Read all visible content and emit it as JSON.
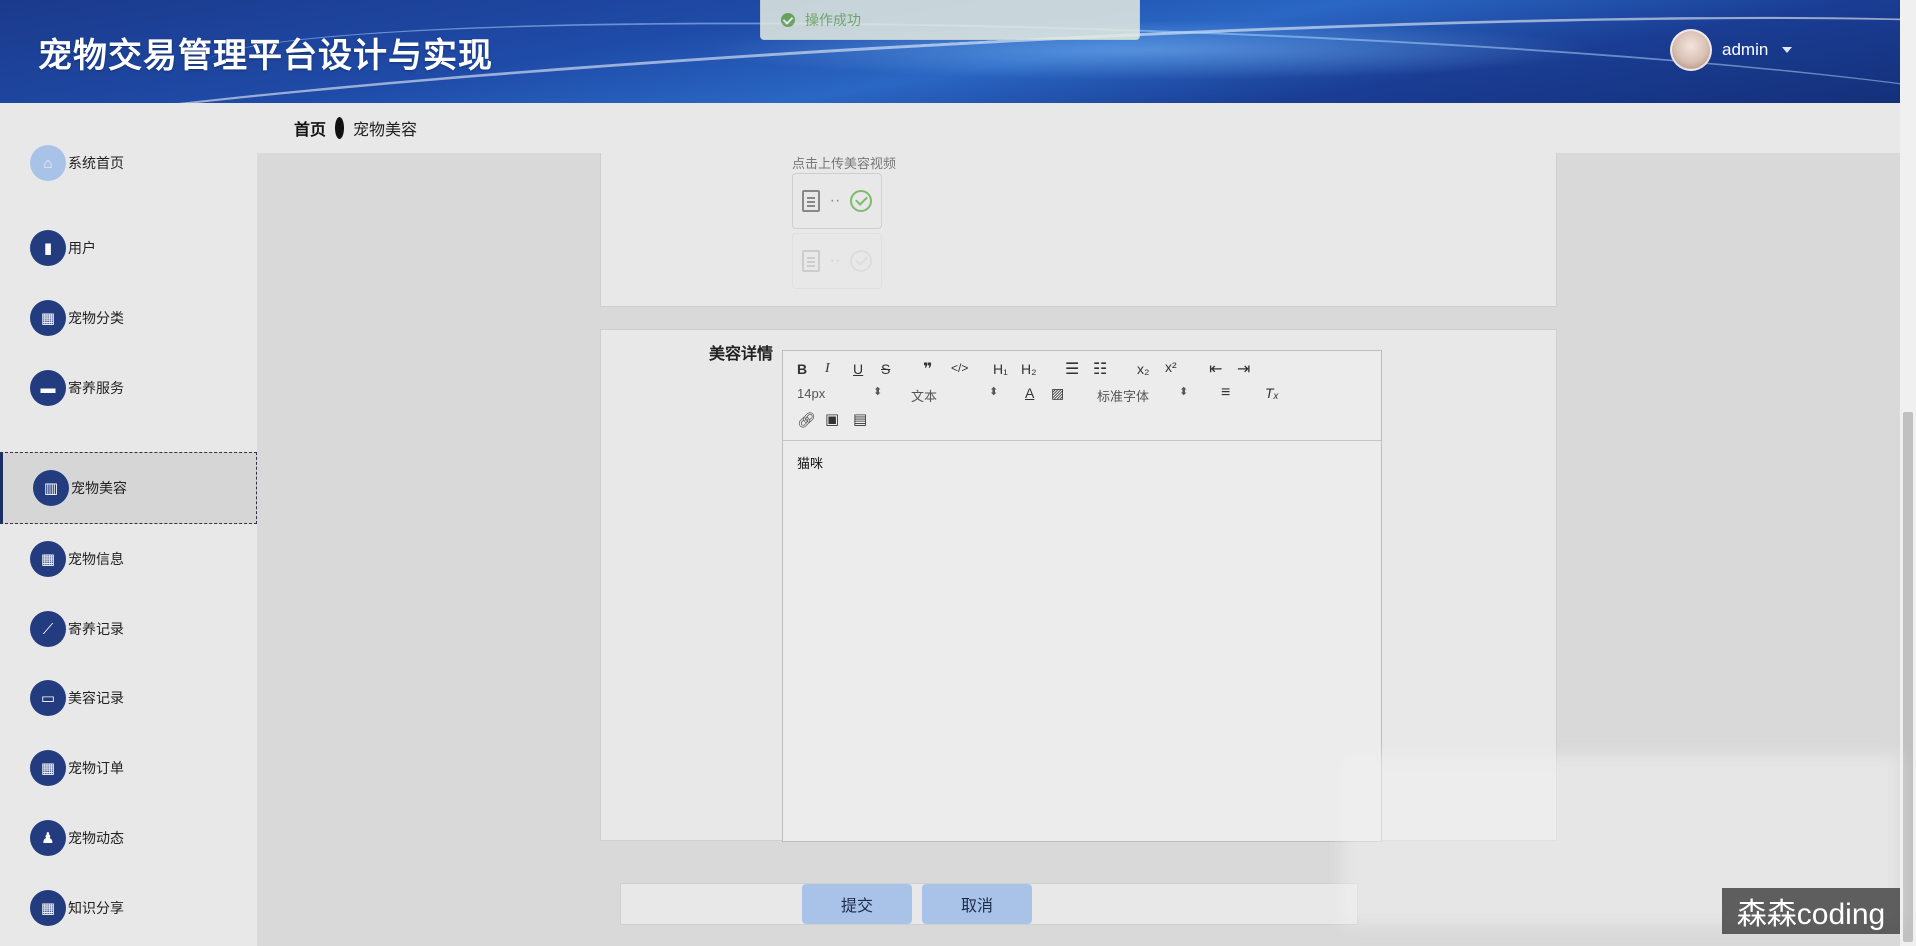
{
  "header": {
    "app_title": "宠物交易管理平台设计与实现",
    "username": "admin"
  },
  "toast": {
    "message": "操作成功"
  },
  "breadcrumb": {
    "home": "首页",
    "current": "宠物美容"
  },
  "sidebar": {
    "items": [
      {
        "label": "系统首页",
        "icon": "home-icon",
        "glyph": "⌂"
      },
      {
        "label": "用户",
        "icon": "user-icon",
        "glyph": "▮"
      },
      {
        "label": "宠物分类",
        "icon": "grid-icon",
        "glyph": "▦"
      },
      {
        "label": "寄养服务",
        "icon": "ticket-icon",
        "glyph": "▬"
      },
      {
        "label": "宠物美容",
        "icon": "bar-chart-icon",
        "glyph": "▥"
      },
      {
        "label": "宠物信息",
        "icon": "grid-icon",
        "glyph": "▦"
      },
      {
        "label": "寄养记录",
        "icon": "line-chart-icon",
        "glyph": "⟋"
      },
      {
        "label": "美容记录",
        "icon": "printer-icon",
        "glyph": "▭"
      },
      {
        "label": "宠物订单",
        "icon": "grid-icon",
        "glyph": "▦"
      },
      {
        "label": "宠物动态",
        "icon": "stamp-icon",
        "glyph": "♟"
      },
      {
        "label": "知识分享",
        "icon": "grid-icon",
        "glyph": "▦"
      }
    ],
    "active_index": 4
  },
  "upload": {
    "hint": "点击上传美容视频"
  },
  "detail": {
    "label": "美容详情",
    "font_size": "14px",
    "block_format": "文本",
    "font_family": "标准字体",
    "content": "猫咪"
  },
  "actions": {
    "submit": "提交",
    "cancel": "取消"
  },
  "watermark": "森森coding",
  "colors": {
    "header_blue": "#1f4ba8",
    "nav_icon": "#233b7f",
    "button": "#a9c3e8",
    "toast_green": "#7cb35f"
  }
}
